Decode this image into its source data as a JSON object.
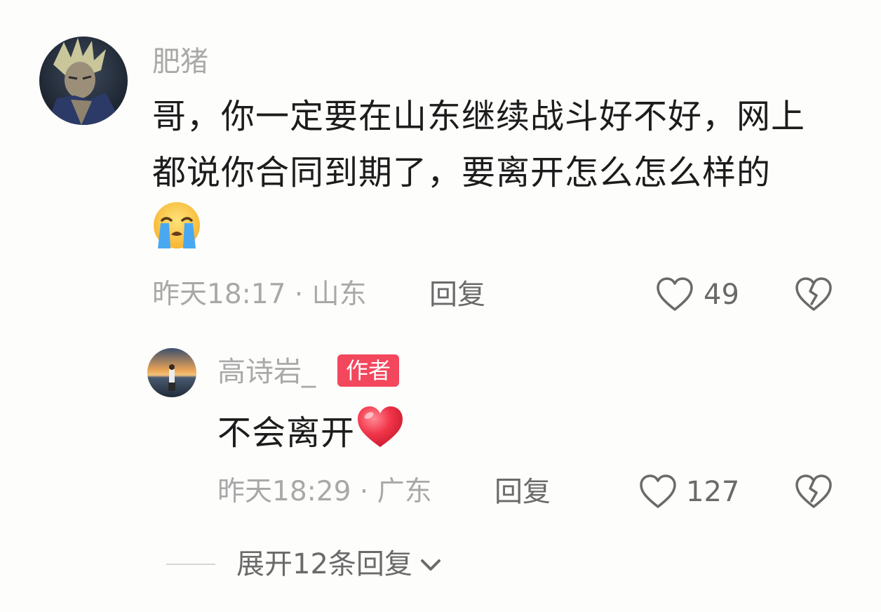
{
  "comment": {
    "username": "肥猪",
    "text": "哥，你一定要在山东继续战斗好不好，网上都说你合同到期了，要离开怎么怎么样的",
    "emoji": "crying-face",
    "meta": "昨天18:17 · 山东",
    "reply_label": "回复",
    "like_count": "49"
  },
  "reply": {
    "username": "高诗岩_",
    "badge": "作者",
    "text": "不会离开",
    "emoji": "red-heart",
    "meta": "昨天18:29 · 广东",
    "reply_label": "回复",
    "like_count": "127"
  },
  "expand_label": "展开12条回复",
  "colors": {
    "badge_bg": "#f2475d",
    "text_primary": "#1c1c1c",
    "text_muted": "#a8a8a8",
    "action_gray": "#6a6a6a",
    "background": "#fdfdfb"
  },
  "icons": {
    "like": "heart-outline-icon",
    "dislike": "broken-heart-icon",
    "expand": "chevron-down-icon"
  }
}
